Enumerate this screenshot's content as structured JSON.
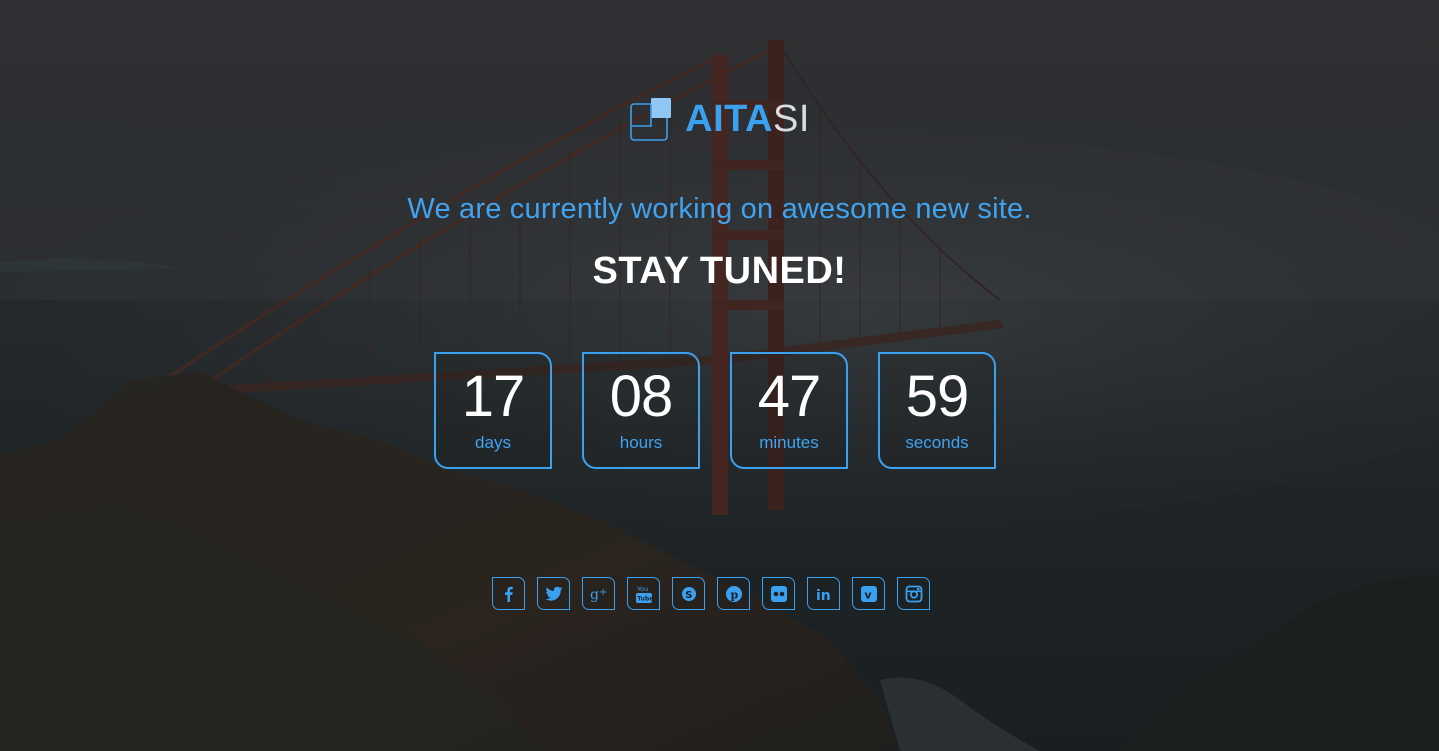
{
  "brand": {
    "name_strong": "AITA",
    "name_light": "SI",
    "accent_color": "#3aa0f0"
  },
  "tagline": "We are currently working on awesome new site.",
  "headline": "STAY TUNED!",
  "countdown": [
    {
      "value": "17",
      "label": "days"
    },
    {
      "value": "08",
      "label": "hours"
    },
    {
      "value": "47",
      "label": "minutes"
    },
    {
      "value": "59",
      "label": "seconds"
    }
  ],
  "social": [
    {
      "icon": "facebook-icon"
    },
    {
      "icon": "twitter-icon"
    },
    {
      "icon": "google-plus-icon"
    },
    {
      "icon": "youtube-icon"
    },
    {
      "icon": "skype-icon"
    },
    {
      "icon": "pinterest-icon"
    },
    {
      "icon": "flickr-icon"
    },
    {
      "icon": "linkedin-icon"
    },
    {
      "icon": "vimeo-icon"
    },
    {
      "icon": "instagram-icon"
    }
  ]
}
